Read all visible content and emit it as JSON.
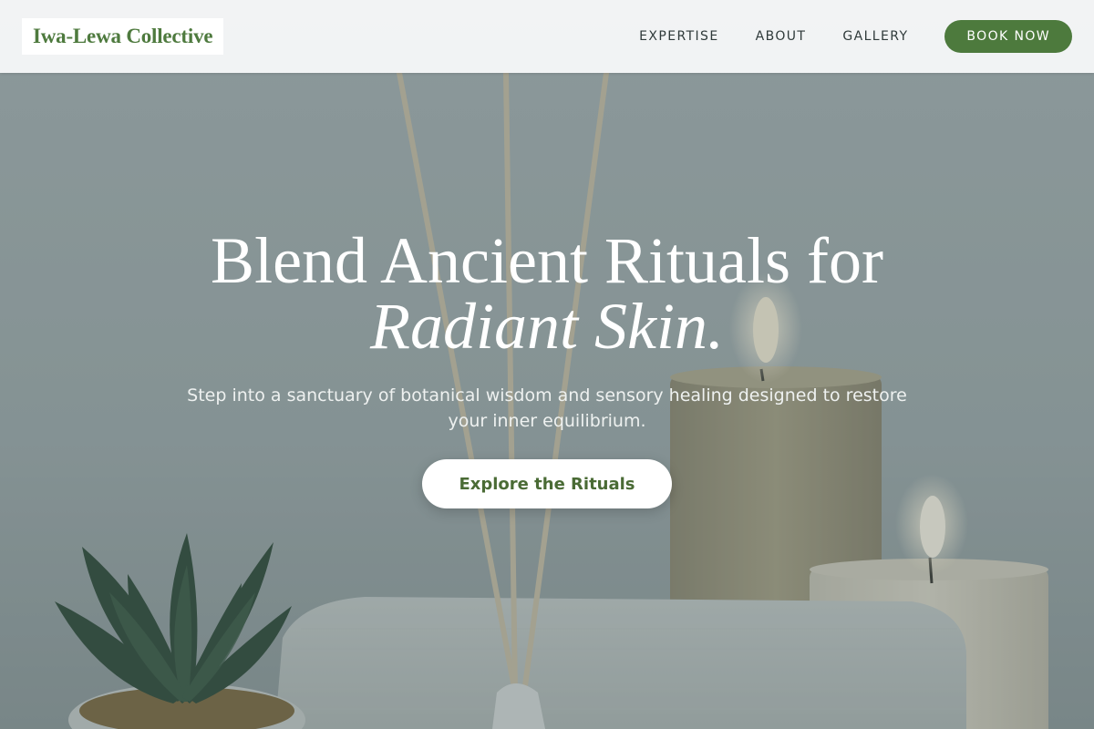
{
  "header": {
    "brand": "Iwa-Lewa Collective",
    "nav": [
      {
        "label": "EXPERTISE"
      },
      {
        "label": "ABOUT"
      },
      {
        "label": "GALLERY"
      }
    ],
    "book_label": "BOOK NOW"
  },
  "hero": {
    "title_line1": "Blend Ancient Rituals for",
    "title_line2": "Radiant Skin.",
    "subtitle": "Step into a sanctuary of botanical wisdom and sensory healing designed to restore your inner equilibrium.",
    "cta_label": "Explore the Rituals",
    "background_image": "spa-scene-image"
  },
  "colors": {
    "accent_green": "#4d7a3d",
    "header_bg": "#f6f7f8",
    "hero_text": "#ffffff"
  }
}
